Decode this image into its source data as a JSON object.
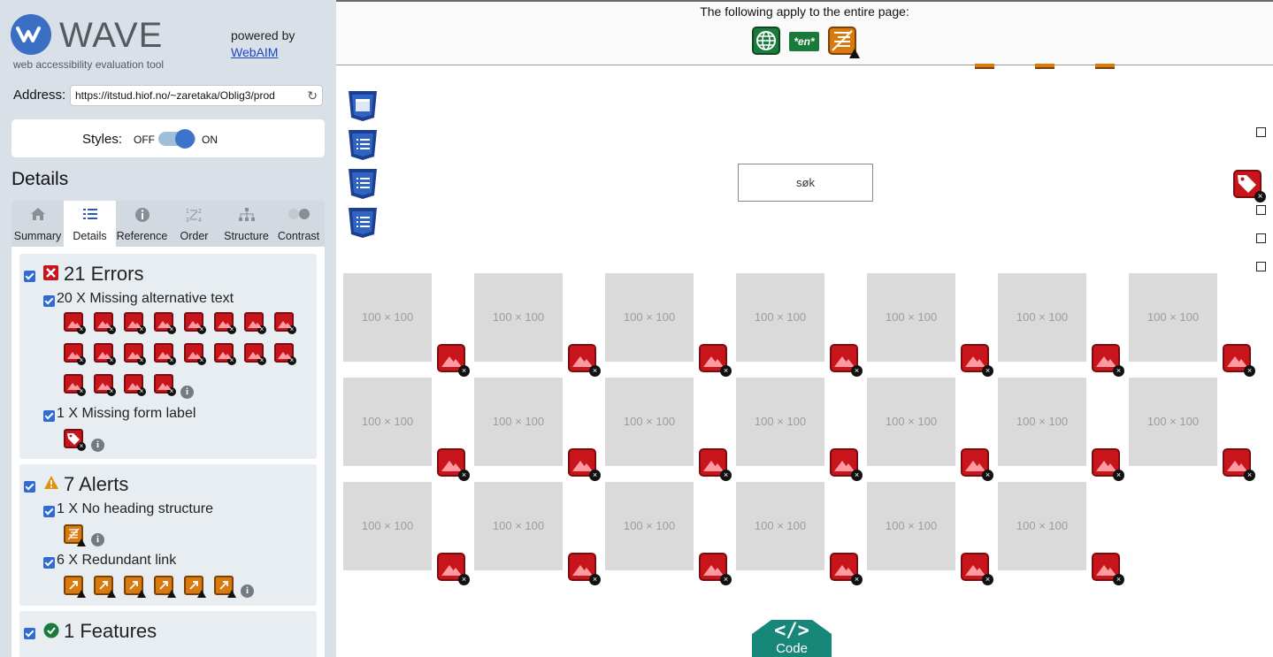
{
  "app": {
    "logo_text": "WAVE",
    "logo_subtitle": "web accessibility evaluation tool",
    "powered_by": "powered by",
    "powered_link": "WebAIM"
  },
  "address": {
    "label": "Address:",
    "value": "https://itstud.hiof.no/~zaretaka/Oblig3/prod"
  },
  "styles": {
    "label": "Styles:",
    "off": "OFF",
    "on": "ON",
    "state": "on"
  },
  "details_title": "Details",
  "tabs": [
    {
      "label": "Summary",
      "icon": "home-icon"
    },
    {
      "label": "Details",
      "icon": "list-icon",
      "active": true
    },
    {
      "label": "Reference",
      "icon": "info-icon"
    },
    {
      "label": "Order",
      "icon": "order-icon"
    },
    {
      "label": "Structure",
      "icon": "structure-icon"
    },
    {
      "label": "Contrast",
      "icon": "contrast-icon"
    }
  ],
  "errors": {
    "title": "21 Errors",
    "items": [
      {
        "label": "20 X Missing alternative text",
        "count": 20
      },
      {
        "label": "1 X Missing form label",
        "count": 1
      }
    ]
  },
  "alerts": {
    "title": "7 Alerts",
    "items": [
      {
        "label": "1 X No heading structure",
        "count": 1
      },
      {
        "label": "6 X Redundant link",
        "count": 6
      }
    ]
  },
  "features": {
    "title": "1 Features"
  },
  "page": {
    "banner": "The following apply to the entire page:",
    "lang_badge": "*en*",
    "search_button": "søk",
    "placeholder_text": "100 × 100",
    "placeholder_count": 20,
    "code_button": "Code",
    "code_glyph": "</>"
  },
  "colors": {
    "error": "#c8151b",
    "alert": "#d97a0e",
    "feature": "#1a7a3c",
    "accent": "#3d74c9",
    "structure": "#1d3f8f",
    "code_tab": "#17877a"
  }
}
